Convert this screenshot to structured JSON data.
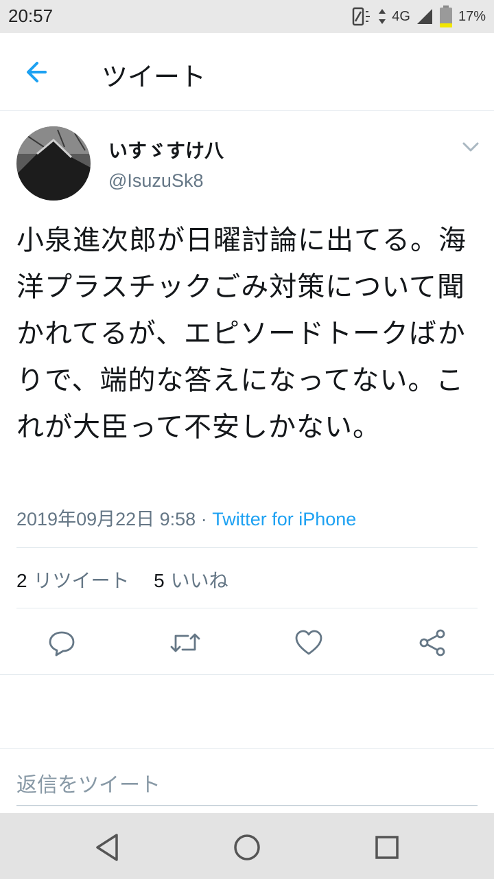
{
  "status_bar": {
    "time": "20:57",
    "network": "4G",
    "battery": "17%"
  },
  "header": {
    "title": "ツイート",
    "back_icon": "arrow-left-icon"
  },
  "tweet": {
    "display_name": "いすゞすけ八",
    "handle": "@IsuzuSk8",
    "text": "小泉進次郎が日曜討論に出てる。海洋プラスチックごみ対策について聞かれてるが、エピソードトークばかりで、端的な答えになってない。これが大臣って不安しかない。",
    "timestamp": "2019年09月22日 9:58",
    "separator": " · ",
    "source": "Twitter for iPhone",
    "retweet_count": "2",
    "retweet_label": "リツイート",
    "like_count": "5",
    "like_label": "いいね"
  },
  "actions": [
    "reply-icon",
    "retweet-icon",
    "like-icon",
    "share-icon"
  ],
  "reply": {
    "placeholder": "返信をツイート"
  },
  "colors": {
    "accent": "#1da1f2",
    "secondary_text": "#657786",
    "divider": "#e1e8ed"
  }
}
